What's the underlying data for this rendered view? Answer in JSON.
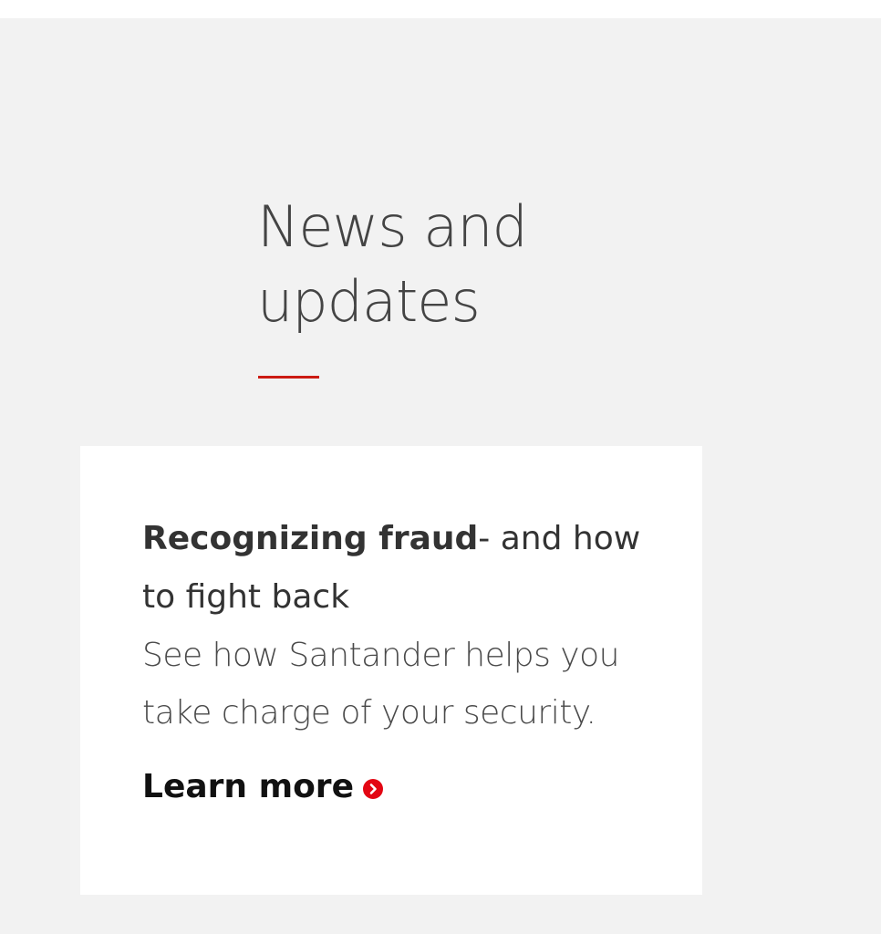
{
  "section": {
    "heading_line1": "News and",
    "heading_line2": "updates",
    "accent_color": "#cc1b13",
    "background_color": "#f2f2f2"
  },
  "card": {
    "title_bold": "Recognizing fraud",
    "title_rest": "- and how to fight back",
    "description": "See how Santander helps you take charge of your security.",
    "link_label": "Learn more",
    "link_icon": "chevron-right-circle-icon"
  }
}
